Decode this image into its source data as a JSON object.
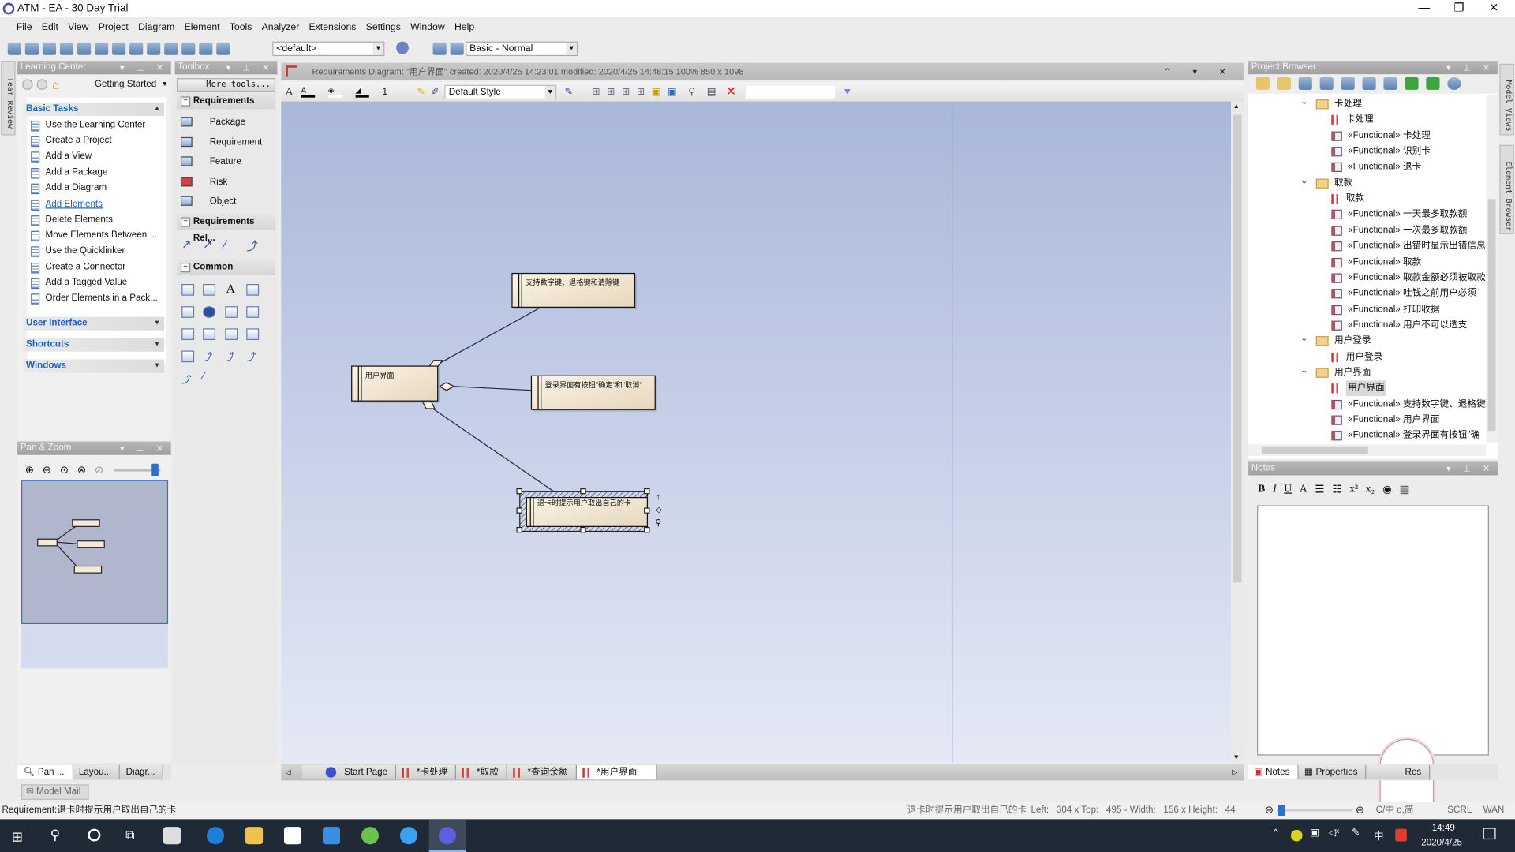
{
  "window": {
    "title": "ATM - EA - 30 Day Trial",
    "controls": [
      "minimize",
      "restore",
      "close"
    ]
  },
  "menu": [
    "File",
    "Edit",
    "View",
    "Project",
    "Diagram",
    "Element",
    "Tools",
    "Analyzer",
    "Extensions",
    "Settings",
    "Window",
    "Help"
  ],
  "toolbar": {
    "perspective_combo": "<default>",
    "workspace_combo": "Basic - Normal"
  },
  "left_strip": {
    "label": "Team Review"
  },
  "learning_center": {
    "title": "Learning Center",
    "nav_combo": "Getting Started",
    "sections": [
      {
        "label": "Basic Tasks",
        "expanded": true,
        "items": [
          "Use the Learning Center",
          "Create a Project",
          "Add a View",
          "Add a Package",
          "Add a Diagram",
          "Add Elements",
          "Delete Elements",
          "Move Elements Between ...",
          "Use the Quicklinker",
          "Create a Connector",
          "Add a Tagged Value",
          "Order Elements in a Pack..."
        ],
        "hovered_item": "Add Elements"
      },
      {
        "label": "User Interface",
        "expanded": false
      },
      {
        "label": "Shortcuts",
        "expanded": false
      },
      {
        "label": "Windows",
        "expanded": false
      }
    ]
  },
  "pan_zoom": {
    "title": "Pan & Zoom",
    "zoom_slider_value": 0.9
  },
  "left_tabs": [
    "Pan ...",
    "Layou...",
    "Diagr..."
  ],
  "model_mail": "Model Mail",
  "toolbox": {
    "title": "Toolbox",
    "more_tools": "More tools...",
    "sections": [
      {
        "label": "Requirements",
        "items": [
          "Package",
          "Requirement",
          "Feature",
          "Risk",
          "Object"
        ]
      },
      {
        "label": "Requirements Rel..."
      },
      {
        "label": "Common"
      }
    ]
  },
  "diagram": {
    "header": "Requirements Diagram: \"用户界面\"  created: 2020/4/25 14:23:01  modified: 2020/4/25 14:48:15   100%   850 x 1098",
    "line_width": "1",
    "style_combo": "Default Style",
    "elements": [
      {
        "id": "support",
        "label": "支持数字键、退格键和清除键"
      },
      {
        "id": "ui",
        "label": "用户界面"
      },
      {
        "id": "login",
        "label": "登录界面有按钮\"确定\"和\"取消\""
      },
      {
        "id": "eject",
        "label": "退卡时提示用户取出自己的卡",
        "selected": true
      }
    ],
    "connectors": [
      {
        "from": "ui",
        "to": "support",
        "type": "aggregation"
      },
      {
        "from": "ui",
        "to": "login",
        "type": "aggregation"
      },
      {
        "from": "ui",
        "to": "eject",
        "type": "aggregation"
      }
    ],
    "tabs": [
      {
        "label": "Start Page",
        "active": false
      },
      {
        "label": "*卡处理",
        "active": false
      },
      {
        "label": "*取款",
        "active": false
      },
      {
        "label": "*查询余额",
        "active": false
      },
      {
        "label": "*用户界面",
        "active": true
      }
    ]
  },
  "project_browser": {
    "title": "Project Browser",
    "tree": [
      {
        "level": 0,
        "type": "folder",
        "label": "卡处理"
      },
      {
        "level": 1,
        "type": "diagram",
        "label": "卡处理"
      },
      {
        "level": 1,
        "type": "req",
        "label": "«Functional» 卡处理"
      },
      {
        "level": 1,
        "type": "req",
        "label": "«Functional» 识别卡"
      },
      {
        "level": 1,
        "type": "req",
        "label": "«Functional» 退卡"
      },
      {
        "level": 0,
        "type": "folder",
        "label": "取款"
      },
      {
        "level": 1,
        "type": "diagram",
        "label": "取款"
      },
      {
        "level": 1,
        "type": "req",
        "label": "«Functional» 一天最多取款额"
      },
      {
        "level": 1,
        "type": "req",
        "label": "«Functional» 一次最多取款额"
      },
      {
        "level": 1,
        "type": "req",
        "label": "«Functional» 出错时显示出错信息"
      },
      {
        "level": 1,
        "type": "req",
        "label": "«Functional» 取款"
      },
      {
        "level": 1,
        "type": "req",
        "label": "«Functional» 取款金额必须被取款"
      },
      {
        "level": 1,
        "type": "req",
        "label": "«Functional» 吐钱之前用户必须"
      },
      {
        "level": 1,
        "type": "req",
        "label": "«Functional» 打印收据"
      },
      {
        "level": 1,
        "type": "req",
        "label": "«Functional» 用户不可以透支"
      },
      {
        "level": 0,
        "type": "folder",
        "label": "用户登录"
      },
      {
        "level": 1,
        "type": "diagram",
        "label": "用户登录"
      },
      {
        "level": 0,
        "type": "folder",
        "label": "用户界面"
      },
      {
        "level": 1,
        "type": "diagram",
        "label": "用户界面",
        "selected": true
      },
      {
        "level": 1,
        "type": "req",
        "label": "«Functional» 支持数字键、退格键"
      },
      {
        "level": 1,
        "type": "req",
        "label": "«Functional» 用户界面"
      },
      {
        "level": 1,
        "type": "req",
        "label": "«Functional» 登录界面有按钮\"确"
      }
    ]
  },
  "notes": {
    "title": "Notes",
    "content": "",
    "tabs": [
      "Notes",
      "Properties",
      "Res"
    ]
  },
  "right_strip": {
    "labels": [
      "Model Views",
      "Element Browser"
    ]
  },
  "status": {
    "left": "Requirement:退卡时提示用户取出自己的卡",
    "element": "退卡时提示用户取出自己的卡",
    "position": "Left:   304 x Top:   495 - Width:   156 x Height:   44",
    "ime": "C/中 o,简",
    "indicators": [
      "SCRL",
      "WAN"
    ]
  },
  "taskbar": {
    "time": "14:49",
    "date": "2020/4/25",
    "ime": "中"
  }
}
